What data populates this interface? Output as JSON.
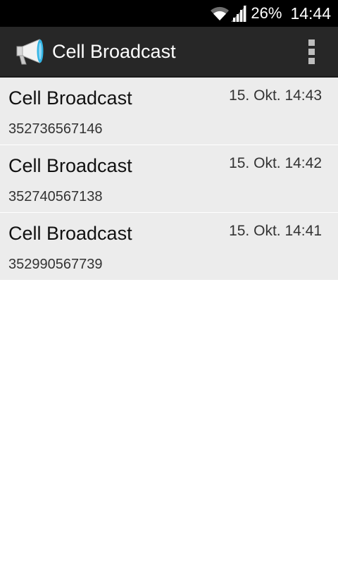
{
  "status_bar": {
    "battery": "26%",
    "time": "14:44",
    "icons": [
      "wifi-icon",
      "signal-icon"
    ]
  },
  "action_bar": {
    "title": "Cell Broadcast",
    "app_icon": "megaphone-icon",
    "menu_icon": "overflow-menu-icon"
  },
  "messages": [
    {
      "title": "Cell Broadcast",
      "time": "15. Okt. 14:43",
      "number": "352736567146"
    },
    {
      "title": "Cell Broadcast",
      "time": "15. Okt. 14:42",
      "number": "352740567138"
    },
    {
      "title": "Cell Broadcast",
      "time": "15. Okt. 14:41",
      "number": "352990567739"
    }
  ],
  "colors": {
    "status_bar_bg": "#000000",
    "action_bar_bg": "#272727",
    "list_item_bg": "#ececec",
    "icon_accent": "#33b5e5"
  }
}
